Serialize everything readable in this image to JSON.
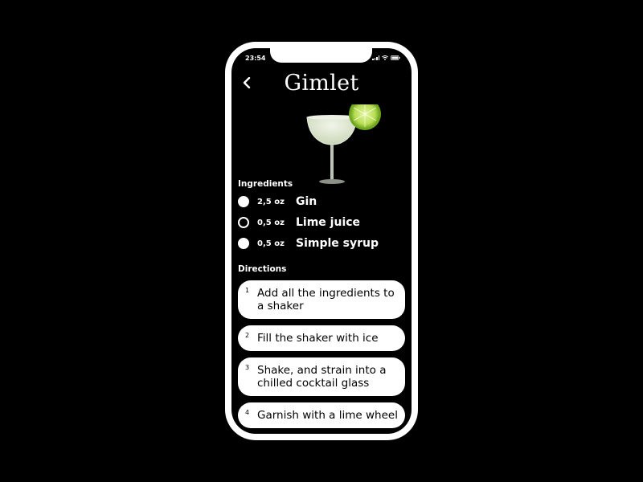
{
  "status": {
    "time": "23:54"
  },
  "header": {
    "title": "Gimlet"
  },
  "image": {
    "icon": "cocktail-coupe-glass-with-lime"
  },
  "ingredients": {
    "label": "Ingredients",
    "items": [
      {
        "amount": "2,5 oz",
        "name": "Gin",
        "checked": true
      },
      {
        "amount": "0,5 oz",
        "name": "Lime juice",
        "checked": false
      },
      {
        "amount": "0,5 oz",
        "name": "Simple syrup",
        "checked": true
      }
    ]
  },
  "directions": {
    "label": "Directions",
    "steps": [
      {
        "number": "1",
        "text": "Add all the ingredients to a shaker"
      },
      {
        "number": "2",
        "text": "Fill the shaker with ice"
      },
      {
        "number": "3",
        "text": "Shake, and strain into a chilled cocktail glass"
      },
      {
        "number": "4",
        "text": "Garnish with a lime wheel"
      }
    ]
  },
  "colors": {
    "background": "#000000",
    "frame": "#ffffff",
    "lime": "#9ccc3a",
    "drink": "#dfe8d2"
  }
}
